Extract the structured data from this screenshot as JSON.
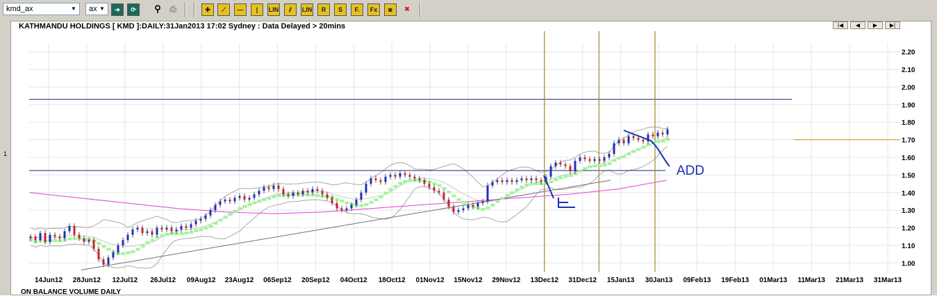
{
  "toolbar": {
    "symbol_value": "kmd_ax",
    "exchange_value": "ax",
    "buttons": [
      {
        "name": "draw-line-button",
        "glyph": "⟋"
      },
      {
        "name": "horizontal-line-button",
        "glyph": "—"
      },
      {
        "name": "vertical-line-button",
        "glyph": "|"
      },
      {
        "name": "linear-regression-button",
        "glyph": "LIN"
      },
      {
        "name": "parallel-lines-button",
        "glyph": "⫽"
      },
      {
        "name": "linear-channel-button",
        "glyph": "LIN"
      },
      {
        "name": "r-tool-button",
        "glyph": "R"
      },
      {
        "name": "s-tool-button",
        "glyph": "S"
      },
      {
        "name": "fibonacci-button",
        "glyph": "F."
      },
      {
        "name": "fibonacci-ext-button",
        "glyph": "Fx"
      },
      {
        "name": "text-tool-button",
        "glyph": "◙"
      },
      {
        "name": "delete-drawing-button",
        "glyph": "✖"
      }
    ]
  },
  "chart_title": "KATHMANDU HOLDINGS [ KMD ]:DAILY:31Jan2013 17:02 Sydney : Data Delayed > 20mins",
  "side_label": "1",
  "lower_panel_title": "ON BALANCE VOLUME DAILY",
  "nav_buttons": [
    "|◀",
    "◀",
    "▶",
    "▶|"
  ],
  "colors": {
    "up_candle": "#1f2fbf",
    "down_candle": "#d0202b",
    "bollinger": "#a8a8a8",
    "signal_dots": "#9ff59a",
    "ma_line": "#e040d8",
    "trendline": "#707070",
    "h_lines": "#1a237e",
    "v_lines": "#a08a20",
    "orange_line": "#e08a10",
    "annotation": "#1c2fb8"
  },
  "chart_data": {
    "type": "candlestick",
    "y_ticks": [
      "1.00",
      "1.10",
      "1.20",
      "1.30",
      "1.40",
      "1.50",
      "1.60",
      "1.70",
      "1.80",
      "1.90",
      "2.00",
      "2.10",
      "2.20"
    ],
    "ylim": [
      0.95,
      2.25
    ],
    "x_ticks": [
      "14Jun12",
      "28Jun12",
      "12Jul12",
      "26Jul12",
      "09Aug12",
      "23Aug12",
      "06Sep12",
      "20Sep12",
      "04Oct12",
      "18Oct12",
      "01Nov12",
      "15Nov12",
      "29Nov12",
      "13Dec12",
      "31Dec12",
      "15Jan13",
      "30Jan13",
      "09Feb13",
      "19Feb13",
      "01Mar13",
      "11Mar13",
      "21Mar13",
      "31Mar13"
    ],
    "closes": [
      1.15,
      1.13,
      1.17,
      1.12,
      1.16,
      1.15,
      1.14,
      1.18,
      1.21,
      1.16,
      1.14,
      1.12,
      1.13,
      1.08,
      1.02,
      0.99,
      1.03,
      1.06,
      1.1,
      1.13,
      1.16,
      1.19,
      1.2,
      1.17,
      1.18,
      1.16,
      1.2,
      1.19,
      1.2,
      1.18,
      1.19,
      1.21,
      1.2,
      1.22,
      1.24,
      1.25,
      1.27,
      1.3,
      1.33,
      1.35,
      1.36,
      1.35,
      1.37,
      1.38,
      1.36,
      1.37,
      1.39,
      1.41,
      1.43,
      1.42,
      1.44,
      1.42,
      1.39,
      1.38,
      1.4,
      1.39,
      1.41,
      1.4,
      1.42,
      1.41,
      1.39,
      1.37,
      1.34,
      1.31,
      1.3,
      1.31,
      1.33,
      1.36,
      1.4,
      1.45,
      1.48,
      1.47,
      1.46,
      1.49,
      1.5,
      1.49,
      1.51,
      1.5,
      1.49,
      1.48,
      1.47,
      1.45,
      1.43,
      1.41,
      1.4,
      1.36,
      1.32,
      1.29,
      1.3,
      1.31,
      1.33,
      1.32,
      1.34,
      1.35,
      1.44,
      1.46,
      1.47,
      1.46,
      1.47,
      1.46,
      1.47,
      1.48,
      1.47,
      1.48,
      1.47,
      1.46,
      1.49,
      1.55,
      1.57,
      1.56,
      1.55,
      1.52,
      1.58,
      1.6,
      1.59,
      1.58,
      1.59,
      1.58,
      1.6,
      1.62,
      1.68,
      1.7,
      1.68,
      1.72,
      1.71,
      1.7,
      1.69,
      1.73,
      1.72,
      1.74,
      1.73,
      1.76
    ],
    "horizontal_lines": [
      1.93,
      1.525
    ],
    "orange_level": 1.7,
    "vertical_line_dates": [
      "13Dec12",
      "07Jan13",
      "22Jan13"
    ],
    "trendline": [
      {
        "date": "28Jun12",
        "value": 0.96
      },
      {
        "date": "29Nov12",
        "value": 1.47
      }
    ],
    "moving_average": [
      1.4,
      1.37,
      1.34,
      1.31,
      1.29,
      1.28,
      1.29,
      1.31,
      1.33,
      1.35,
      1.37,
      1.39,
      1.42,
      1.47
    ],
    "annotations": [
      "E",
      "ADD"
    ]
  }
}
